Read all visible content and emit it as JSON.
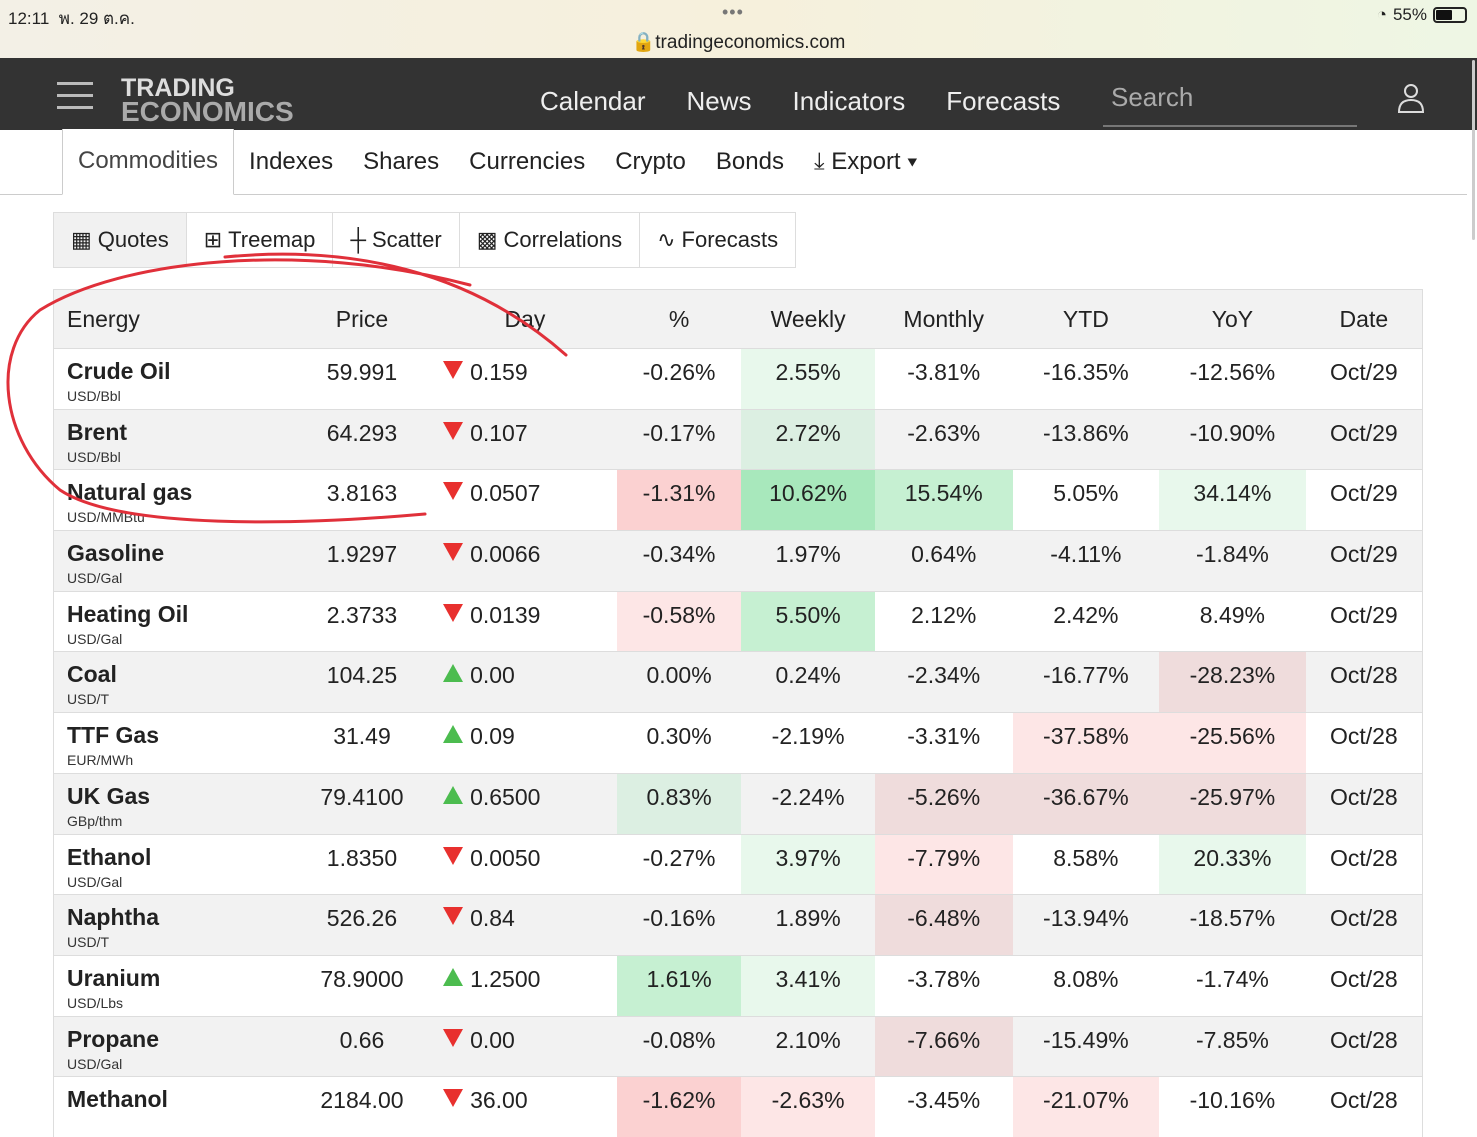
{
  "status": {
    "time": "12:11",
    "date": "พ. 29 ต.ค.",
    "url": "tradingeconomics.com",
    "battery": "55%",
    "battery_level": 0.55
  },
  "nav": {
    "logo_line1": "TRADING",
    "logo_line2": "ECONOMICS",
    "links": [
      "Calendar",
      "News",
      "Indicators",
      "Forecasts"
    ],
    "search_placeholder": "Search"
  },
  "tabs": [
    "Commodities",
    "Indexes",
    "Shares",
    "Currencies",
    "Crypto",
    "Bonds",
    "Export"
  ],
  "views": [
    "Quotes",
    "Treemap",
    "Scatter",
    "Correlations",
    "Forecasts"
  ],
  "table": {
    "headers": [
      "Energy",
      "Price",
      "Day",
      "%",
      "Weekly",
      "Monthly",
      "YTD",
      "YoY",
      "Date"
    ],
    "rows": [
      {
        "name": "Crude Oil",
        "unit": "USD/Bbl",
        "price": "59.991",
        "dir": "down",
        "day": "0.159",
        "pct": "-0.26%",
        "weekly": "2.55%",
        "monthly": "-3.81%",
        "ytd": "-16.35%",
        "yoy": "-12.56%",
        "date": "Oct/29",
        "tints": [
          "",
          "g1",
          "",
          "",
          ""
        ]
      },
      {
        "name": "Brent",
        "unit": "USD/Bbl",
        "price": "64.293",
        "dir": "down",
        "day": "0.107",
        "pct": "-0.17%",
        "weekly": "2.72%",
        "monthly": "-2.63%",
        "ytd": "-13.86%",
        "yoy": "-10.90%",
        "date": "Oct/29",
        "tints": [
          "",
          "g1",
          "",
          "",
          ""
        ]
      },
      {
        "name": "Natural gas",
        "unit": "USD/MMBtu",
        "price": "3.8163",
        "dir": "down",
        "day": "0.0507",
        "pct": "-1.31%",
        "weekly": "10.62%",
        "monthly": "15.54%",
        "ytd": "5.05%",
        "yoy": "34.14%",
        "date": "Oct/29",
        "tints": [
          "r2",
          "g3",
          "g2",
          "",
          "g1"
        ]
      },
      {
        "name": "Gasoline",
        "unit": "USD/Gal",
        "price": "1.9297",
        "dir": "down",
        "day": "0.0066",
        "pct": "-0.34%",
        "weekly": "1.97%",
        "monthly": "0.64%",
        "ytd": "-4.11%",
        "yoy": "-1.84%",
        "date": "Oct/29",
        "tints": [
          "",
          "",
          "",
          "",
          ""
        ]
      },
      {
        "name": "Heating Oil",
        "unit": "USD/Gal",
        "price": "2.3733",
        "dir": "down",
        "day": "0.0139",
        "pct": "-0.58%",
        "weekly": "5.50%",
        "monthly": "2.12%",
        "ytd": "2.42%",
        "yoy": "8.49%",
        "date": "Oct/29",
        "tints": [
          "r1",
          "g2",
          "",
          "",
          ""
        ]
      },
      {
        "name": "Coal",
        "unit": "USD/T",
        "price": "104.25",
        "dir": "up",
        "day": "0.00",
        "pct": "0.00%",
        "weekly": "0.24%",
        "monthly": "-2.34%",
        "ytd": "-16.77%",
        "yoy": "-28.23%",
        "date": "Oct/28",
        "tints": [
          "",
          "",
          "",
          "",
          "r1"
        ]
      },
      {
        "name": "TTF Gas",
        "unit": "EUR/MWh",
        "price": "31.49",
        "dir": "up",
        "day": "0.09",
        "pct": "0.30%",
        "weekly": "-2.19%",
        "monthly": "-3.31%",
        "ytd": "-37.58%",
        "yoy": "-25.56%",
        "date": "Oct/28",
        "tints": [
          "",
          "",
          "",
          "r1",
          "r1"
        ]
      },
      {
        "name": "UK Gas",
        "unit": "GBp/thm",
        "price": "79.4100",
        "dir": "up",
        "day": "0.6500",
        "pct": "0.83%",
        "weekly": "-2.24%",
        "monthly": "-5.26%",
        "ytd": "-36.67%",
        "yoy": "-25.97%",
        "date": "Oct/28",
        "tints": [
          "g1",
          "",
          "r1",
          "r1",
          "r1"
        ]
      },
      {
        "name": "Ethanol",
        "unit": "USD/Gal",
        "price": "1.8350",
        "dir": "down",
        "day": "0.0050",
        "pct": "-0.27%",
        "weekly": "3.97%",
        "monthly": "-7.79%",
        "ytd": "8.58%",
        "yoy": "20.33%",
        "date": "Oct/28",
        "tints": [
          "",
          "g1",
          "r1",
          "",
          "g1"
        ]
      },
      {
        "name": "Naphtha",
        "unit": "USD/T",
        "price": "526.26",
        "dir": "down",
        "day": "0.84",
        "pct": "-0.16%",
        "weekly": "1.89%",
        "monthly": "-6.48%",
        "ytd": "-13.94%",
        "yoy": "-18.57%",
        "date": "Oct/28",
        "tints": [
          "",
          "",
          "r1",
          "",
          ""
        ]
      },
      {
        "name": "Uranium",
        "unit": "USD/Lbs",
        "price": "78.9000",
        "dir": "up",
        "day": "1.2500",
        "pct": "1.61%",
        "weekly": "3.41%",
        "monthly": "-3.78%",
        "ytd": "8.08%",
        "yoy": "-1.74%",
        "date": "Oct/28",
        "tints": [
          "g2",
          "g1",
          "",
          "",
          ""
        ]
      },
      {
        "name": "Propane",
        "unit": "USD/Gal",
        "price": "0.66",
        "dir": "down",
        "day": "0.00",
        "pct": "-0.08%",
        "weekly": "2.10%",
        "monthly": "-7.66%",
        "ytd": "-15.49%",
        "yoy": "-7.85%",
        "date": "Oct/28",
        "tints": [
          "",
          "",
          "r1",
          "",
          ""
        ]
      },
      {
        "name": "Methanol",
        "unit": "",
        "price": "2184.00",
        "dir": "down",
        "day": "36.00",
        "pct": "-1.62%",
        "weekly": "-2.63%",
        "monthly": "-3.45%",
        "ytd": "-21.07%",
        "yoy": "-10.16%",
        "date": "Oct/28",
        "tints": [
          "r2",
          "r1",
          "",
          "r1",
          ""
        ]
      }
    ]
  }
}
